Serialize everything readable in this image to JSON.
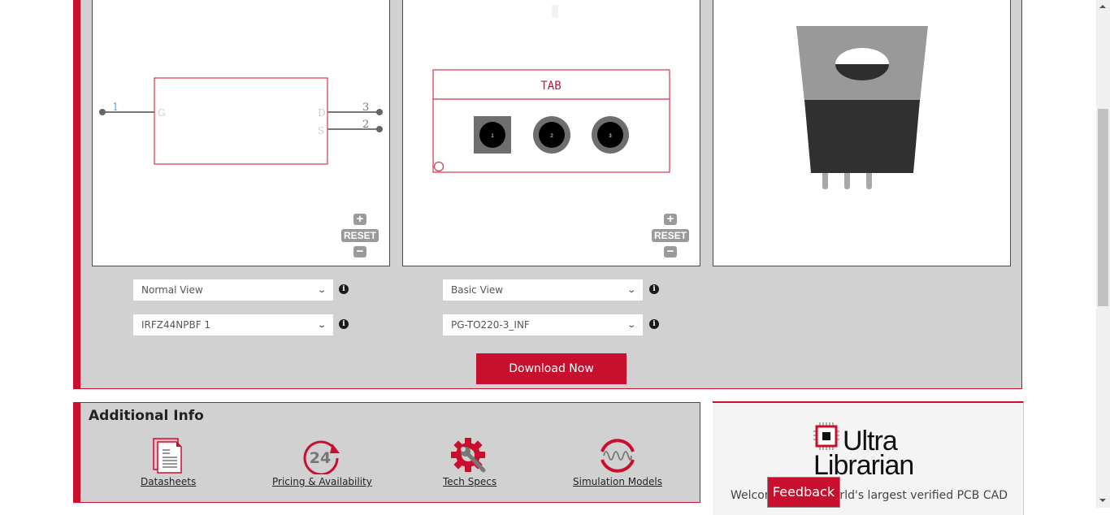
{
  "schematic": {
    "pins": [
      {
        "number": "1",
        "name": "G"
      },
      {
        "number": "3",
        "name": "D"
      },
      {
        "number": "2",
        "name": "S"
      }
    ]
  },
  "footprint": {
    "label": "TAB",
    "pads": [
      "1",
      "2",
      "3"
    ]
  },
  "zoom_controls": {
    "plus": "+",
    "reset": "RESET",
    "minus": "−"
  },
  "selects": {
    "symbol_view": "Normal View",
    "footprint_view": "Basic View",
    "symbol_part": "IRFZ44NPBF 1",
    "footprint_package": "PG-TO220-3_INF"
  },
  "info_icon": "i",
  "download_label": "Download Now",
  "additional_info": {
    "title": "Additional Info",
    "items": [
      {
        "label": "Datasheets",
        "icon": "datasheet-icon"
      },
      {
        "label": "Pricing & Availability",
        "icon": "24-hour-icon"
      },
      {
        "label": "Tech Specs",
        "icon": "gear-wrench-icon"
      },
      {
        "label": "Simulation Models",
        "icon": "waveform-icon"
      }
    ]
  },
  "ultra_librarian": {
    "logo_line1": "Ultra",
    "logo_line2": "Librarian",
    "welcome_text": "Welcome to the world's largest verified PCB CAD"
  },
  "feedback_label": "Feedback",
  "colors": {
    "brand_red": "#c8102e",
    "panel_gray": "#d1d1d1"
  }
}
